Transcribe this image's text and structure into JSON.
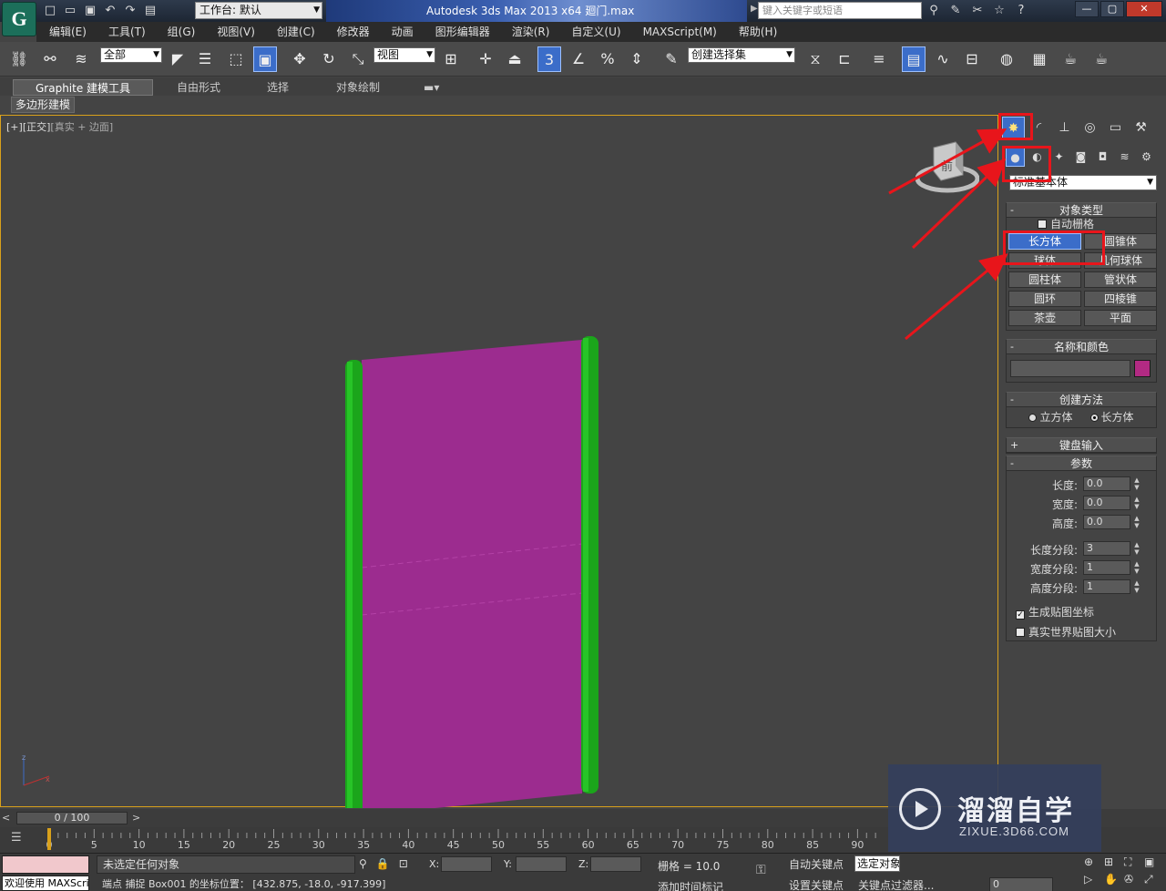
{
  "titlebar": {
    "workspace_label": "工作台: 默认",
    "app_title": "Autodesk 3ds Max  2013 x64      廻门.max",
    "search_placeholder": "键入关键字或短语",
    "quick_access_icons": [
      "new-file-icon",
      "open-file-icon",
      "save-icon",
      "undo-icon",
      "redo-icon",
      "project-folder-icon"
    ],
    "help_tools": [
      "binoculars-icon",
      "communication-icon",
      "subscription-icon",
      "favorites-icon",
      "help-icon"
    ]
  },
  "menu": [
    "编辑(E)",
    "工具(T)",
    "组(G)",
    "视图(V)",
    "创建(C)",
    "修改器",
    "动画",
    "图形编辑器",
    "渲染(R)",
    "自定义(U)",
    "MAXScript(M)",
    "帮助(H)"
  ],
  "toolbar": {
    "selection_filter": "全部",
    "reference_coord": "视图",
    "named_selection": "创建选择集",
    "snap_number": "3"
  },
  "ribbon": {
    "active_tab": "Graphite 建模工具",
    "tabs": [
      "自由形式",
      "选择",
      "对象绘制"
    ],
    "subtab": "多边形建模"
  },
  "viewport": {
    "label_bracket1": "[+]",
    "label_bracket2": "[正交]",
    "label_shading": "[真实 + 边面]",
    "viewcube_label": "前"
  },
  "command_panel": {
    "type_dropdown": "标准基本体",
    "object_type": {
      "title": "对象类型",
      "autogrid": "自动栅格",
      "buttons": [
        "长方体",
        "圆锥体",
        "球体",
        "几何球体",
        "圆柱体",
        "管状体",
        "圆环",
        "四棱锥",
        "茶壶",
        "平面"
      ],
      "active": "长方体"
    },
    "name_color": {
      "title": "名称和颜色",
      "color": "#b22a83"
    },
    "creation_method": {
      "title": "创建方法",
      "options": [
        "立方体",
        "长方体"
      ],
      "selected": "长方体"
    },
    "keyboard_entry": "键盘输入",
    "parameters": {
      "title": "参数",
      "length_label": "长度:",
      "length": "0.0",
      "width_label": "宽度:",
      "width": "0.0",
      "height_label": "高度:",
      "height": "0.0",
      "length_segs_label": "长度分段:",
      "length_segs": "3",
      "width_segs_label": "宽度分段:",
      "width_segs": "1",
      "height_segs_label": "高度分段:",
      "height_segs": "1",
      "gen_map_coords": "生成贴图坐标",
      "real_world_map": "真实世界贴图大小"
    }
  },
  "timeline": {
    "frame_range": "0 / 100",
    "ticks": [
      "0",
      "5",
      "10",
      "15",
      "20",
      "25",
      "30",
      "35",
      "40",
      "45",
      "50",
      "55",
      "60",
      "65",
      "70",
      "75",
      "80",
      "85",
      "90"
    ]
  },
  "status": {
    "maxscript": "欢迎使用 MAXScri",
    "line1": "未选定任何对象",
    "line2": "端点 捕捉 Box001 的坐标位置：  [432.875, -18.0, -917.399]",
    "x_label": "X:",
    "y_label": "Y:",
    "z_label": "Z:",
    "grid": "栅格 = 10.0",
    "auto_key": "自动关键点",
    "set_key": "设置关键点",
    "selection_dd": "选定对象",
    "add_time_tag": "添加时间标记",
    "key_filters": "关键点过滤器...",
    "frame": "0"
  },
  "watermark": {
    "title": "溜溜自学",
    "url": "ZIXUE.3D66.COM"
  }
}
